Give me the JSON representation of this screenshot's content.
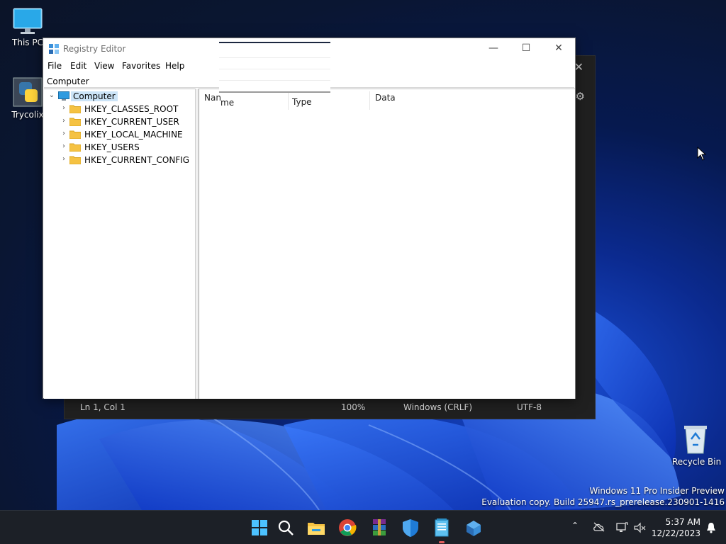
{
  "desktop": {
    "icons": [
      {
        "label": "This PC"
      },
      {
        "label": "Trycolix"
      },
      {
        "label": "Recycle Bin"
      }
    ],
    "watermark": {
      "line1": "Windows 11 Pro Insider Preview",
      "line2": "Evaluation copy. Build 25947.rs_prerelease.230901-1416"
    }
  },
  "notepad": {
    "status": {
      "position": "Ln 1, Col 1",
      "zoom": "100%",
      "line_ending": "Windows (CRLF)",
      "encoding": "UTF-8"
    }
  },
  "regedit": {
    "title": "Registry Editor",
    "menu": [
      "File",
      "Edit",
      "View",
      "Favorites",
      "Help"
    ],
    "address": "Computer",
    "tree": {
      "root": "Computer",
      "children": [
        "HKEY_CLASSES_ROOT",
        "HKEY_CURRENT_USER",
        "HKEY_LOCAL_MACHINE",
        "HKEY_USERS",
        "HKEY_CURRENT_CONFIG"
      ]
    },
    "columns": {
      "name_partial": "Nan",
      "name_tail": "me",
      "type": "Type",
      "data": "Data"
    }
  },
  "taskbar": {
    "clock": {
      "time": "5:37 AM",
      "date": "12/22/2023"
    },
    "apps": [
      "start-icon",
      "search-icon",
      "file-explorer-icon",
      "chrome-icon",
      "winrar-icon",
      "security-shield-icon",
      "notepad-icon",
      "regedit-icon"
    ]
  },
  "colors": {
    "accent": "#0078d4",
    "folder": "#f5c242",
    "taskbar": "#1c2027"
  }
}
